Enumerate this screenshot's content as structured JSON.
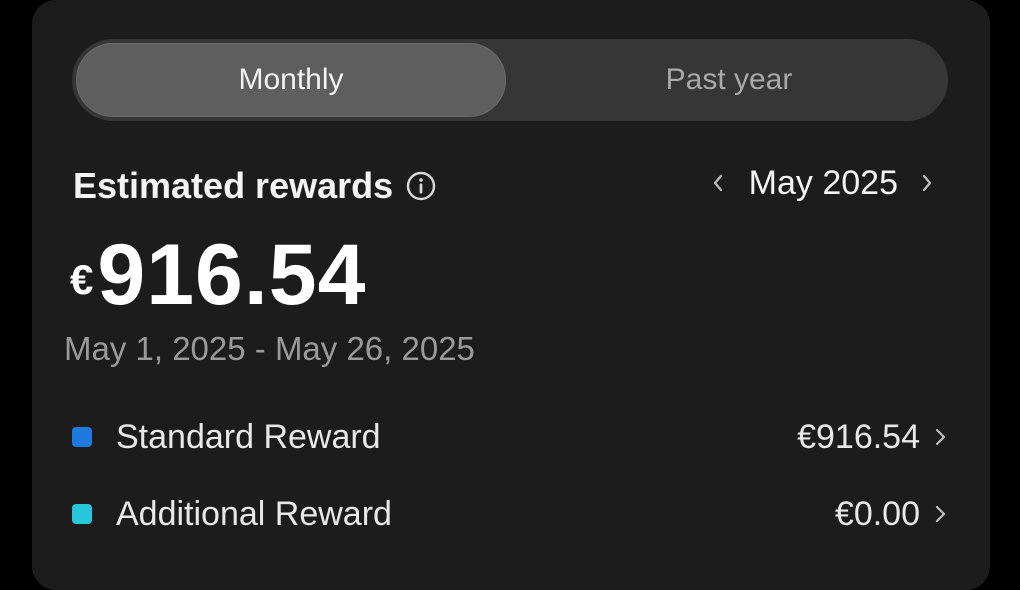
{
  "tabs": [
    {
      "label": "Monthly",
      "active": true
    },
    {
      "label": "Past year",
      "active": false
    }
  ],
  "rewards": {
    "title": "Estimated rewards",
    "info_icon": "info-icon",
    "month": "May 2025",
    "currency_symbol": "€",
    "amount": "916.54",
    "date_range": "May 1, 2025 - May 26, 2025",
    "items": [
      {
        "label": "Standard Reward",
        "value": "€916.54",
        "color": "#1f7ae0"
      },
      {
        "label": "Additional Reward",
        "value": "€0.00",
        "color": "#28c6dc"
      }
    ]
  },
  "colors": {
    "background": "#000000",
    "card": "#1c1c1c",
    "segment_track": "#363636",
    "segment_active": "#5e5e5e"
  }
}
